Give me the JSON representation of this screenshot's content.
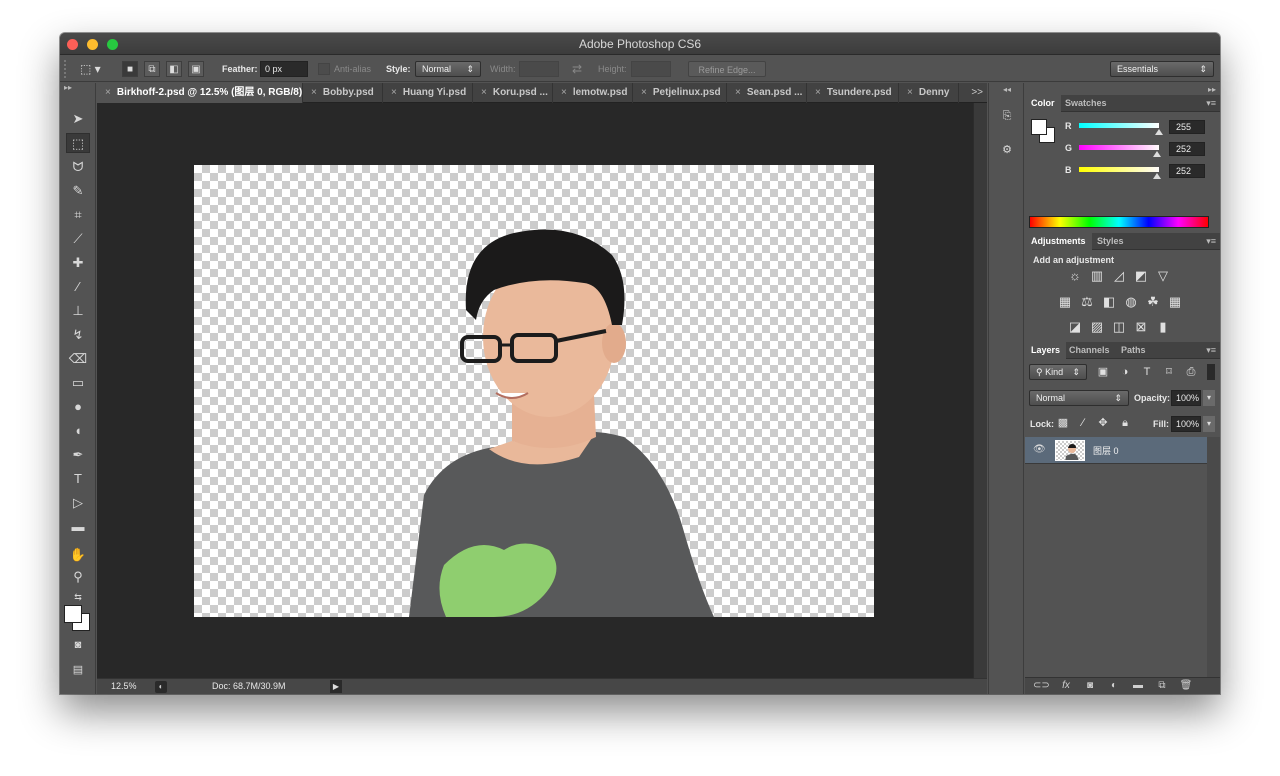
{
  "window": {
    "title": "Adobe Photoshop CS6"
  },
  "options": {
    "feather_label": "Feather:",
    "feather_value": "0 px",
    "antialias_label": "Anti-alias",
    "style_label": "Style:",
    "style_value": "Normal",
    "width_label": "Width:",
    "height_label": "Height:",
    "refine_edge": "Refine Edge...",
    "workspace": "Essentials"
  },
  "tabs": [
    {
      "label": "Birkhoff-2.psd @ 12.5% (图层 0, RGB/8)"
    },
    {
      "label": "Bobby.psd"
    },
    {
      "label": "Huang Yi.psd"
    },
    {
      "label": "Koru.psd ..."
    },
    {
      "label": "lemotw.psd"
    },
    {
      "label": "Petjelinux.psd"
    },
    {
      "label": "Sean.psd ..."
    },
    {
      "label": "Tsundere.psd"
    },
    {
      "label": "Denny"
    }
  ],
  "tabs_more": ">>",
  "status": {
    "zoom": "12.5%",
    "doc": "Doc: 68.7M/30.9M"
  },
  "color_panel": {
    "tabs": [
      "Color",
      "Swatches"
    ],
    "r_label": "R",
    "g_label": "G",
    "b_label": "B",
    "r": "255",
    "g": "252",
    "b": "252",
    "r_color": "#00ffff",
    "g_color": "#ff00ff",
    "b_color": "#ffff00"
  },
  "adjustments_panel": {
    "tabs": [
      "Adjustments",
      "Styles"
    ],
    "heading": "Add an adjustment"
  },
  "layers_panel": {
    "tabs": [
      "Layers",
      "Channels",
      "Paths"
    ],
    "kind": "Kind",
    "blend_mode": "Normal",
    "opacity_label": "Opacity:",
    "opacity_value": "100%",
    "lock_label": "Lock:",
    "fill_label": "Fill:",
    "fill_value": "100%",
    "layer_name": "图层 0"
  }
}
